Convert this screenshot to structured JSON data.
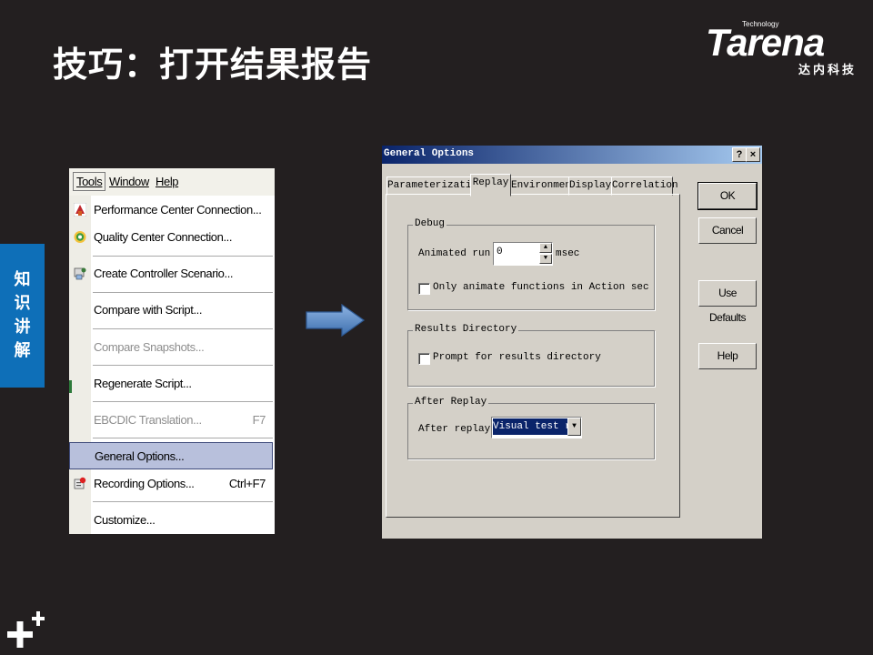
{
  "slide": {
    "title": "技巧：打开结果报告",
    "side_tab": [
      "知",
      "识",
      "讲",
      "解"
    ]
  },
  "brand": {
    "tech": "Technology",
    "name": "Tarena",
    "cn": "达内科技"
  },
  "menu": {
    "bar": {
      "tools": "Tools",
      "window": "Window",
      "help": "Help"
    },
    "items": [
      {
        "label": "Performance Center Connection...",
        "shortcut": "",
        "icon": "performance-center-icon",
        "state": "normal"
      },
      {
        "label": "Quality Center Connection...",
        "shortcut": "",
        "icon": "quality-center-icon",
        "state": "normal"
      },
      {
        "label": "Create Controller Scenario...",
        "shortcut": "",
        "icon": "controller-scenario-icon",
        "state": "normal"
      },
      {
        "label": "Compare with Script...",
        "shortcut": "",
        "icon": "",
        "state": "normal"
      },
      {
        "label": "Compare Snapshots...",
        "shortcut": "",
        "icon": "",
        "state": "disabled"
      },
      {
        "label": "Regenerate Script...",
        "shortcut": "",
        "icon": "",
        "state": "normal"
      },
      {
        "label": "EBCDIC Translation...",
        "shortcut": "F7",
        "icon": "",
        "state": "disabled"
      },
      {
        "label": "General Options...",
        "shortcut": "",
        "icon": "",
        "state": "selected"
      },
      {
        "label": "Recording Options...",
        "shortcut": "Ctrl+F7",
        "icon": "recording-options-icon",
        "state": "normal"
      },
      {
        "label": "Customize...",
        "shortcut": "",
        "icon": "",
        "state": "normal"
      }
    ]
  },
  "dialog": {
    "title": "General Options",
    "title_buttons": {
      "help": "?",
      "close": "×"
    },
    "tabs": [
      "Parameterization",
      "Replay",
      "Environment",
      "Display",
      "Correlation"
    ],
    "active_tab": "Replay",
    "debug": {
      "group_label": "Debug",
      "animated_run_label": "Animated run",
      "animated_run_value": "0",
      "unit": "msec",
      "only_animate_label": "Only animate functions in Action sec",
      "only_animate_checked": false
    },
    "results_directory": {
      "group_label": "Results Directory",
      "prompt_label": "Prompt for results directory",
      "prompt_checked": false
    },
    "after_replay": {
      "group_label": "After Replay",
      "after_replay_label": "After replay",
      "after_replay_value": "Visual test resu"
    },
    "buttons": {
      "ok": "OK",
      "cancel": "Cancel",
      "use_defaults": "Use Defaults",
      "help": "Help"
    }
  },
  "colors": {
    "background": "#231f20",
    "side_tab": "#0e6fb8",
    "arrow": "#4f81bd",
    "dialog_face": "#d4d0c8",
    "title_bar": "#0a246a",
    "menu_selected": "#b8c0dc"
  }
}
